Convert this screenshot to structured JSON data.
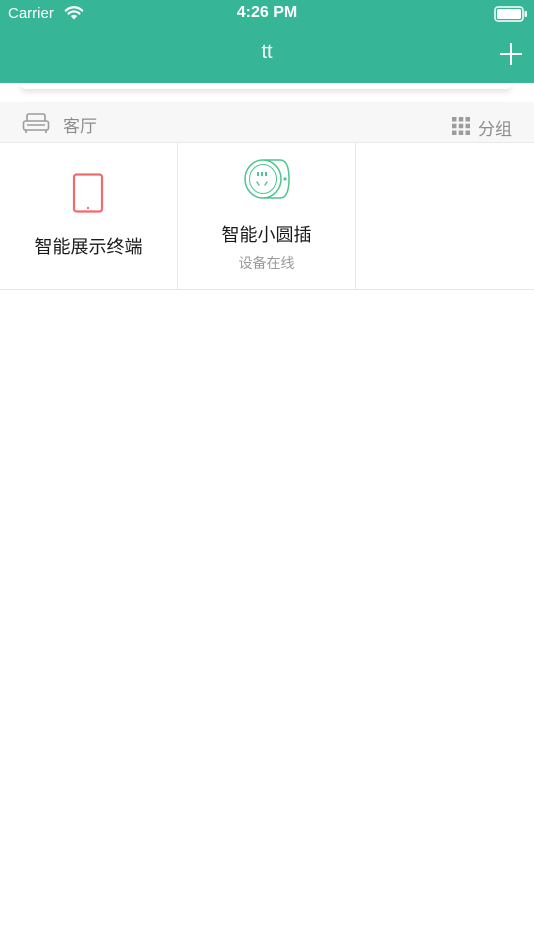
{
  "status_bar": {
    "carrier": "Carrier",
    "time": "4:26 PM"
  },
  "nav": {
    "title": "tt"
  },
  "room": {
    "name": "客厅",
    "group_label": "分组"
  },
  "devices": [
    {
      "name": "智能展示终端",
      "status": ""
    },
    {
      "name": "智能小圆插",
      "status": "设备在线"
    }
  ],
  "colors": {
    "header": "#36b697",
    "tablet_icon": "#f06b6b",
    "plug_icon": "#4fc48e"
  },
  "icons": {
    "add": "plus-icon",
    "room": "sofa-icon",
    "group": "grid-icon",
    "device_1": "tablet-icon",
    "device_2": "smart-plug-icon"
  }
}
